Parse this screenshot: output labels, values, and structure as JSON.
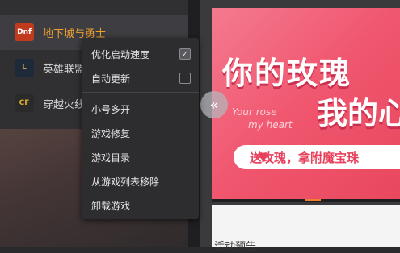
{
  "games": [
    {
      "name": "地下城与勇士",
      "logo": "Dnf",
      "color": "#c23a1e",
      "active": true
    },
    {
      "name": "英雄联盟",
      "logo": "L",
      "color": "#1d2a3a",
      "active": false
    },
    {
      "name": "穿越火线",
      "logo": "CF",
      "color": "#2a2a2a",
      "active": false
    }
  ],
  "context_menu": {
    "optimize_speed": {
      "label": "优化启动速度",
      "checked": true
    },
    "auto_update": {
      "label": "自动更新",
      "checked": false
    },
    "multi_open": "小号多开",
    "repair": "游戏修复",
    "directory": "游戏目录",
    "remove": "从游戏列表移除",
    "uninstall": "卸载游戏"
  },
  "banner": {
    "line1": "你的玫瑰",
    "line2": "我的心",
    "english1": "Your rose",
    "english2": "my heart",
    "promo": "送玫瑰，拿附魔宝珠"
  },
  "activity_title": "活动预告",
  "icons": {
    "prev": "chevron-left-icon",
    "check": "check-icon",
    "heart": "heart-icon"
  }
}
